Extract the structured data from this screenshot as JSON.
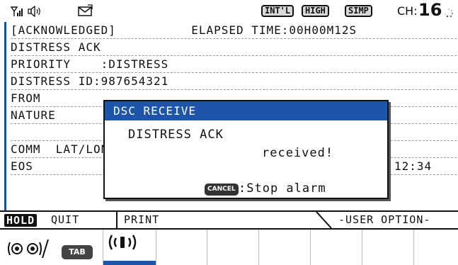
{
  "status": {
    "modes": [
      "INT'L",
      "HIGH",
      "SIMP"
    ],
    "channel_label": "CH:",
    "channel_value": "16",
    "icons": [
      "signal-icon",
      "speaker-icon",
      "envelope-icon",
      "busy-spinner-icon"
    ]
  },
  "main": {
    "lines": [
      "[ACKNOWLEDGED]          ELAPSED TIME:00H00M12S",
      "DISTRESS ACK",
      "PRIORITY    :DISTRESS",
      "DISTRESS ID:987654321",
      "FROM",
      "NATURE",
      "LAT/LON/U",
      "COMM",
      "EOS           :ACKNOWLEDGED REQUEST"
    ],
    "lat_time_fragment": "12:34"
  },
  "popup": {
    "title": "DSC RECEIVE",
    "message1": "DISTRESS ACK",
    "message2": "received!",
    "cancel_key": "CANCEL",
    "cancel_text": ":Stop alarm"
  },
  "softkeys": {
    "hold": "HOLD",
    "quit": "QUIT",
    "print": "PRINT",
    "user_option": "-USER OPTION-"
  },
  "tabs": {
    "tab_key": "TAB",
    "icons": [
      "dual-watch-icon",
      "broadcast-icon"
    ]
  },
  "colors": {
    "accent": "#1f55a8",
    "text": "#111111"
  }
}
